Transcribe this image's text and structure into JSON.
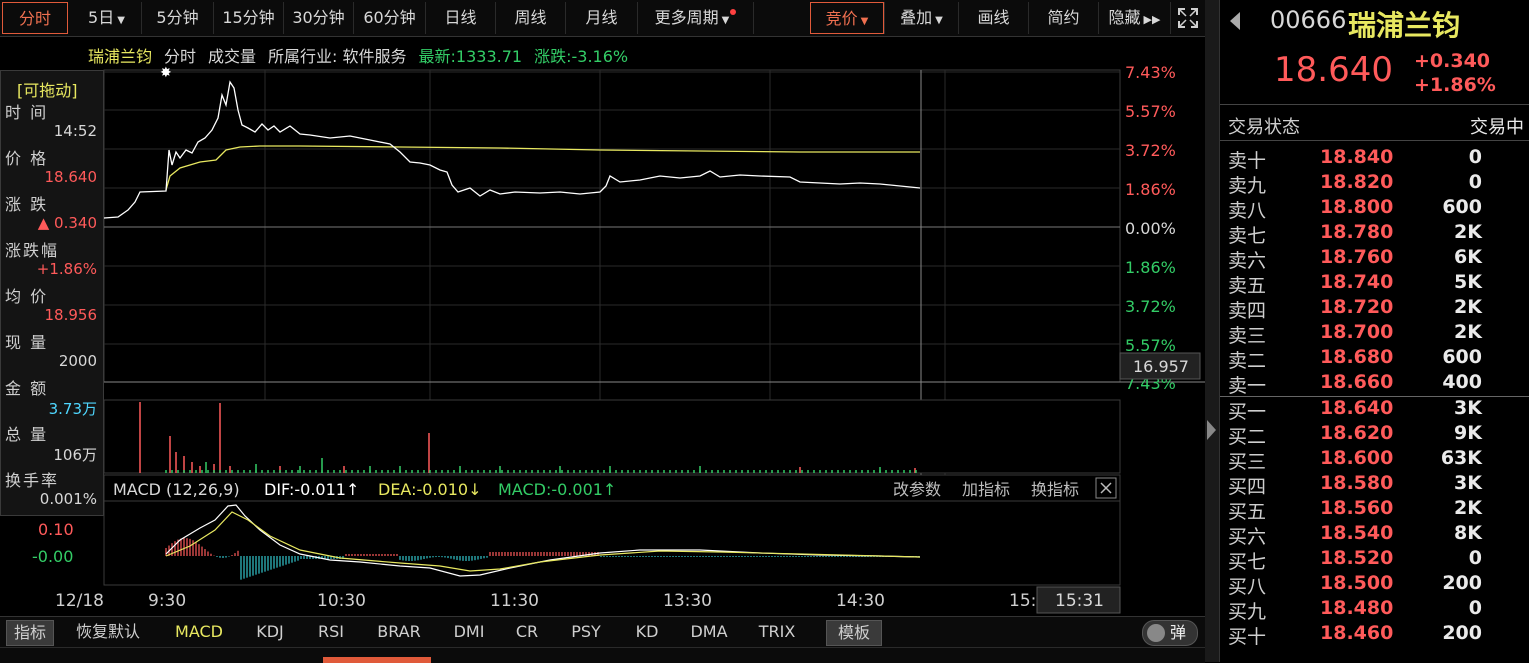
{
  "toolbar": {
    "periods": [
      "分时",
      "5日",
      "5分钟",
      "15分钟",
      "30分钟",
      "60分钟",
      "日线",
      "周线",
      "月线",
      "更多周期"
    ],
    "right": [
      "竞价",
      "叠加",
      "画线",
      "简约",
      "隐藏"
    ]
  },
  "info": {
    "name": "瑞浦兰钧",
    "mode": "分时",
    "volume": "成交量",
    "industry": "所属行业: 软件服务",
    "latest": "最新:1333.71",
    "change": "涨跌:-3.16%"
  },
  "float_panel": {
    "drag": "[可拖动]",
    "items": [
      {
        "label": "时 间",
        "value": "14:52",
        "color": "#d8d8d8"
      },
      {
        "label": "价 格",
        "value": "18.640",
        "color": "#ff5a5a"
      },
      {
        "label": "涨 跌",
        "value": "▲ 0.340",
        "color": "#ff5a5a"
      },
      {
        "label": "涨跌幅",
        "value": "+1.86%",
        "color": "#ff5a5a"
      },
      {
        "label": "均 价",
        "value": "18.956",
        "color": "#ff5a5a"
      },
      {
        "label": "现 量",
        "value": "2000",
        "color": "#d8d8d8"
      },
      {
        "label": "金 额",
        "value": "3.73万",
        "color": "#4fd7ff"
      },
      {
        "label": "总 量",
        "value": "106万",
        "color": "#d8d8d8"
      },
      {
        "label": "换手率",
        "value": "0.001%",
        "color": "#d8d8d8"
      }
    ]
  },
  "right_axis": {
    "labels": [
      "7.43%",
      "5.57%",
      "3.72%",
      "1.86%",
      "0.00%",
      "1.86%",
      "3.72%",
      "5.57%",
      "7.43%"
    ],
    "current": "16.957"
  },
  "macd": {
    "title": "MACD (12,26,9)",
    "dif": "DIF:-0.011↑",
    "dea": "DEA:-0.010↓",
    "value": "MACD:-0.001↑",
    "actions": [
      "改参数",
      "加指标",
      "换指标"
    ],
    "axis": [
      "0.10",
      "-0.00"
    ]
  },
  "time_axis": {
    "labels": [
      "12/18",
      "9:30",
      "10:30",
      "11:30",
      "13:30",
      "14:30",
      "15:"
    ],
    "cursor": "15:31"
  },
  "bottom_tabs": [
    "指标",
    "恢复默认",
    "MACD",
    "KDJ",
    "RSI",
    "BRAR",
    "DMI",
    "CR",
    "PSY",
    "KD",
    "DMA",
    "TRIX",
    "模板"
  ],
  "toggle_label": "弹",
  "quote": {
    "code": "00666",
    "name": "瑞浦兰钧",
    "price": "18.640",
    "change": "+0.340",
    "pct": "+1.86%",
    "status_label": "交易状态",
    "status_value": "交易中",
    "asks": [
      {
        "label": "卖十",
        "price": "18.840",
        "vol": "0"
      },
      {
        "label": "卖九",
        "price": "18.820",
        "vol": "0"
      },
      {
        "label": "卖八",
        "price": "18.800",
        "vol": "600"
      },
      {
        "label": "卖七",
        "price": "18.780",
        "vol": "2K"
      },
      {
        "label": "卖六",
        "price": "18.760",
        "vol": "6K"
      },
      {
        "label": "卖五",
        "price": "18.740",
        "vol": "5K"
      },
      {
        "label": "卖四",
        "price": "18.720",
        "vol": "2K"
      },
      {
        "label": "卖三",
        "price": "18.700",
        "vol": "2K"
      },
      {
        "label": "卖二",
        "price": "18.680",
        "vol": "600"
      },
      {
        "label": "卖一",
        "price": "18.660",
        "vol": "400"
      }
    ],
    "bids": [
      {
        "label": "买一",
        "price": "18.640",
        "vol": "3K"
      },
      {
        "label": "买二",
        "price": "18.620",
        "vol": "9K"
      },
      {
        "label": "买三",
        "price": "18.600",
        "vol": "63K"
      },
      {
        "label": "买四",
        "price": "18.580",
        "vol": "3K"
      },
      {
        "label": "买五",
        "price": "18.560",
        "vol": "2K"
      },
      {
        "label": "买六",
        "price": "18.540",
        "vol": "8K"
      },
      {
        "label": "买七",
        "price": "18.520",
        "vol": "0"
      },
      {
        "label": "买八",
        "price": "18.500",
        "vol": "200"
      },
      {
        "label": "买九",
        "price": "18.480",
        "vol": "0"
      },
      {
        "label": "买十",
        "price": "18.460",
        "vol": "200"
      }
    ]
  },
  "colors": {
    "up": "#ff5a5a",
    "down": "#33cc66",
    "price_line": "#ffffff",
    "avg_line": "#e8e860",
    "accent": "#e05a3a"
  }
}
